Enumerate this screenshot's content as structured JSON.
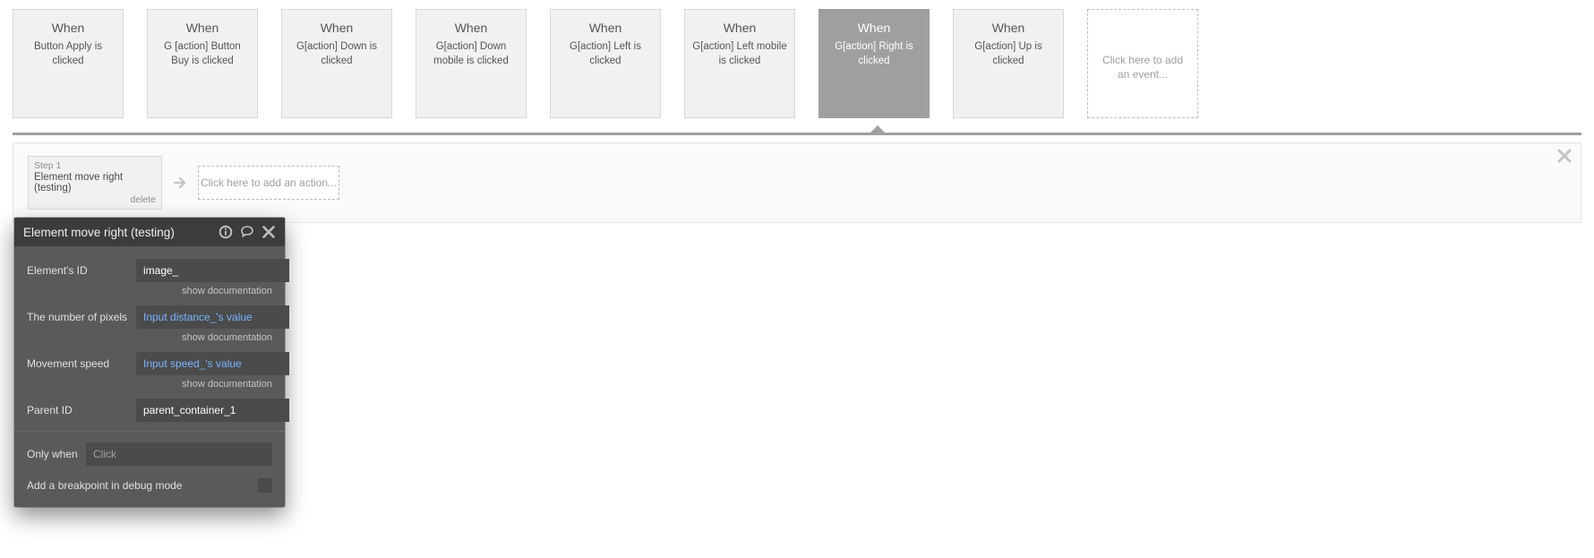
{
  "events": [
    {
      "title": "When",
      "desc": "Button Apply is clicked",
      "selected": false
    },
    {
      "title": "When",
      "desc": "G [action] Button Buy is clicked",
      "selected": false
    },
    {
      "title": "When",
      "desc": "G[action] Down is clicked",
      "selected": false
    },
    {
      "title": "When",
      "desc": "G[action] Down mobile is clicked",
      "selected": false
    },
    {
      "title": "When",
      "desc": "G[action] Left is clicked",
      "selected": false
    },
    {
      "title": "When",
      "desc": "G[action] Left mobile is clicked",
      "selected": false
    },
    {
      "title": "When",
      "desc": "G[action] Right is clicked",
      "selected": true
    },
    {
      "title": "When",
      "desc": "G[action] Up is clicked",
      "selected": false
    }
  ],
  "add_event_text": "Click here to add an event...",
  "workflow": {
    "step_number": "Step 1",
    "step_title": "Element move right (testing)",
    "step_delete": "delete",
    "add_action_text": "Click here to add an action..."
  },
  "panel": {
    "title": "Element move right (testing)",
    "doc_link": "show documentation",
    "fields": {
      "element_id": {
        "label": "Element's ID",
        "value": "image_"
      },
      "pixels": {
        "label": "The number of pixels",
        "value": "Input distance_'s value"
      },
      "speed": {
        "label": "Movement speed",
        "value": "Input speed_'s value"
      },
      "parent_id": {
        "label": "Parent ID",
        "value": "parent_container_1"
      },
      "only_when": {
        "label": "Only when",
        "placeholder": "Click"
      },
      "breakpoint": {
        "label": "Add a breakpoint in debug mode"
      }
    }
  }
}
